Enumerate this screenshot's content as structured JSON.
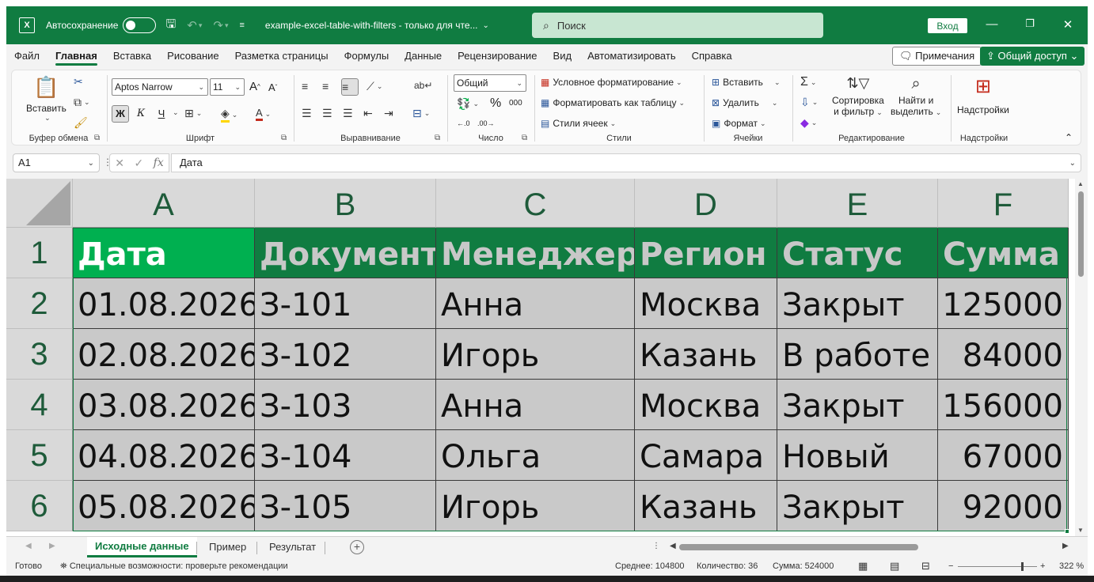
{
  "titlebar": {
    "logo": "X",
    "autosave_label": "Автосохранение",
    "filename": "example-excel-table-with-filters  -  только для чте...",
    "search_placeholder": "Поиск",
    "login_label": "Вход",
    "icons": [
      "excel-logo-icon",
      "save-icon",
      "undo-icon",
      "redo-icon",
      "customize-icon",
      "search-icon",
      "minimize-icon",
      "restore-icon",
      "close-icon"
    ]
  },
  "menu": {
    "tabs": [
      "Файл",
      "Главная",
      "Вставка",
      "Рисование",
      "Разметка страницы",
      "Формулы",
      "Данные",
      "Рецензирование",
      "Вид",
      "Автоматизировать",
      "Справка"
    ],
    "active_tab": "Главная",
    "comments_label": "Примечания",
    "share_label": "Общий доступ"
  },
  "ribbon": {
    "clipboard": {
      "paste": "Вставить",
      "label": "Буфер обмена"
    },
    "font": {
      "name": "Aptos Narrow",
      "size": "11",
      "label": "Шрифт",
      "bold": "Ж",
      "italic": "К",
      "underline": "Ч"
    },
    "alignment": {
      "label": "Выравнивание"
    },
    "number": {
      "format": "Общий",
      "label": "Число",
      "percent": "%",
      "thousands": "000"
    },
    "styles": {
      "conditional": "Условное форматирование",
      "as_table": "Форматировать как таблицу",
      "cell_styles": "Стили ячеек",
      "label": "Стили"
    },
    "cells": {
      "insert": "Вставить",
      "delete": "Удалить",
      "format": "Формат",
      "label": "Ячейки"
    },
    "editing": {
      "sort_line1": "Сортировка",
      "sort_line2": "и фильтр",
      "find_line1": "Найти и",
      "find_line2": "выделить",
      "label": "Редактирование"
    },
    "addins": {
      "button": "Надстройки",
      "label": "Надстройки"
    }
  },
  "formula_bar": {
    "name_box": "A1",
    "formula": "Дата"
  },
  "sheet": {
    "columns": [
      "A",
      "B",
      "C",
      "D",
      "E",
      "F"
    ],
    "rows": [
      "1",
      "2",
      "3",
      "4",
      "5",
      "6"
    ],
    "header": [
      "Дата",
      "Документ",
      "Менеджер",
      "Регион",
      "Статус",
      "Сумма"
    ],
    "data": [
      [
        "01.08.2026",
        "З-101",
        "Анна",
        "Москва",
        "Закрыт",
        "125000"
      ],
      [
        "02.08.2026",
        "З-102",
        "Игорь",
        "Казань",
        "В работе",
        "84000"
      ],
      [
        "03.08.2026",
        "З-103",
        "Анна",
        "Москва",
        "Закрыт",
        "156000"
      ],
      [
        "04.08.2026",
        "З-104",
        "Ольга",
        "Самара",
        "Новый",
        "67000"
      ],
      [
        "05.08.2026",
        "З-105",
        "Игорь",
        "Казань",
        "Закрыт",
        "92000"
      ]
    ]
  },
  "sheet_tabs": {
    "tabs": [
      "Исходные данные",
      "Пример",
      "Результат"
    ],
    "active": "Исходные данные"
  },
  "status": {
    "ready": "Готово",
    "accessibility": "Специальные возможности: проверьте рекомендации",
    "average": "Среднее: 104800",
    "count": "Количество: 36",
    "sum": "Сумма: 524000",
    "zoom": "322 %",
    "zoom_value": 322
  },
  "colors": {
    "accent": "#107c41",
    "header_fill": "#107c41",
    "active_header_fill": "#00b050",
    "cell_fill": "#c9c9c9"
  }
}
